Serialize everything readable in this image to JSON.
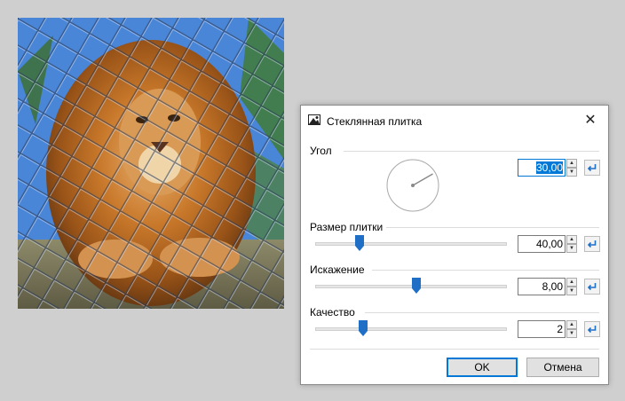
{
  "dialog": {
    "title": "Стеклянная плитка",
    "close_label": "✕",
    "icon": "glass-tile-effect-icon"
  },
  "angle": {
    "label": "Угол",
    "value": "30,00",
    "degrees": 30
  },
  "tile_size": {
    "label": "Размер плитки",
    "value": "40,00",
    "fraction": 0.23
  },
  "distortion": {
    "label": "Искажение",
    "value": "8,00",
    "fraction": 0.53
  },
  "quality": {
    "label": "Качество",
    "value": "2",
    "fraction": 0.25
  },
  "buttons": {
    "ok": "OK",
    "cancel": "Отмена"
  },
  "colors": {
    "accent": "#0078d7",
    "thumb": "#1f6fc7",
    "canvas_sky": "#4a86d8",
    "lion_mane": "#c46a20"
  }
}
